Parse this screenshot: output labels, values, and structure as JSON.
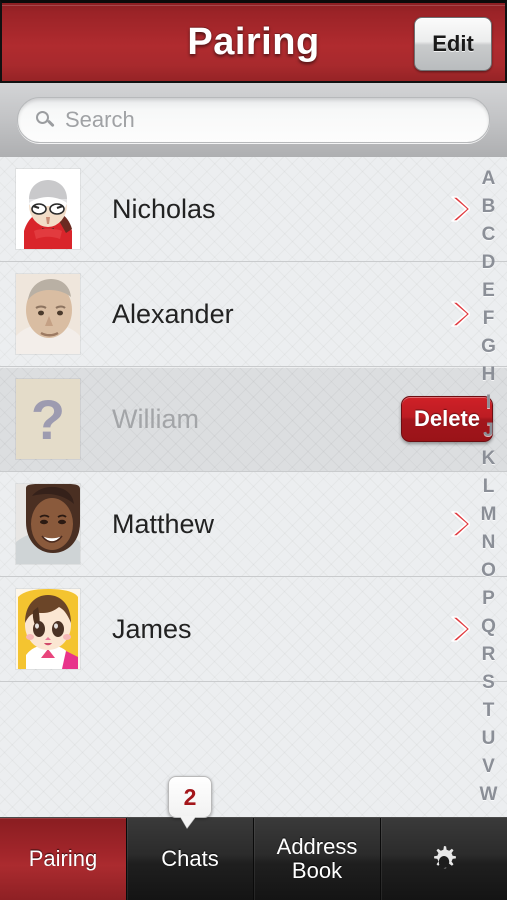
{
  "titlebar": {
    "title": "Pairing",
    "edit_label": "Edit"
  },
  "search": {
    "placeholder": "Search",
    "value": "",
    "icon": "search-icon"
  },
  "contacts": [
    {
      "name": "Nicholas",
      "avatar": "cartoon-skier",
      "accessory": "chevron",
      "state": "normal"
    },
    {
      "name": "Alexander",
      "avatar": "elderly-man",
      "accessory": "chevron",
      "state": "normal"
    },
    {
      "name": "William",
      "avatar": "question-mark",
      "accessory": "delete",
      "state": "deleting"
    },
    {
      "name": "Matthew",
      "avatar": "smiling-woman",
      "accessory": "chevron",
      "state": "normal"
    },
    {
      "name": "James",
      "avatar": "anime-character",
      "accessory": "chevron",
      "state": "normal"
    }
  ],
  "row_actions": {
    "delete_label": "Delete"
  },
  "alpha_index": [
    "A",
    "B",
    "C",
    "D",
    "E",
    "F",
    "G",
    "H",
    "I",
    "J",
    "K",
    "L",
    "M",
    "N",
    "O",
    "P",
    "Q",
    "R",
    "S",
    "T",
    "U",
    "V",
    "W"
  ],
  "tabs": [
    {
      "label": "Pairing",
      "active": true,
      "icon": null,
      "badge": null
    },
    {
      "label": "Chats",
      "active": false,
      "icon": null,
      "badge": "2"
    },
    {
      "label": "Address\nBook",
      "active": false,
      "icon": null,
      "badge": null
    },
    {
      "label": "",
      "active": false,
      "icon": "gear-icon",
      "badge": null
    }
  ],
  "colors": {
    "brand_red": "#a3262b",
    "delete_red": "#bd1d23",
    "chevron_red": "#e03a3f",
    "badge_text": "#a4161b",
    "tab_dark": "#2b2b2b",
    "list_bg": "#eceef0",
    "index_text": "#8b8f97"
  }
}
